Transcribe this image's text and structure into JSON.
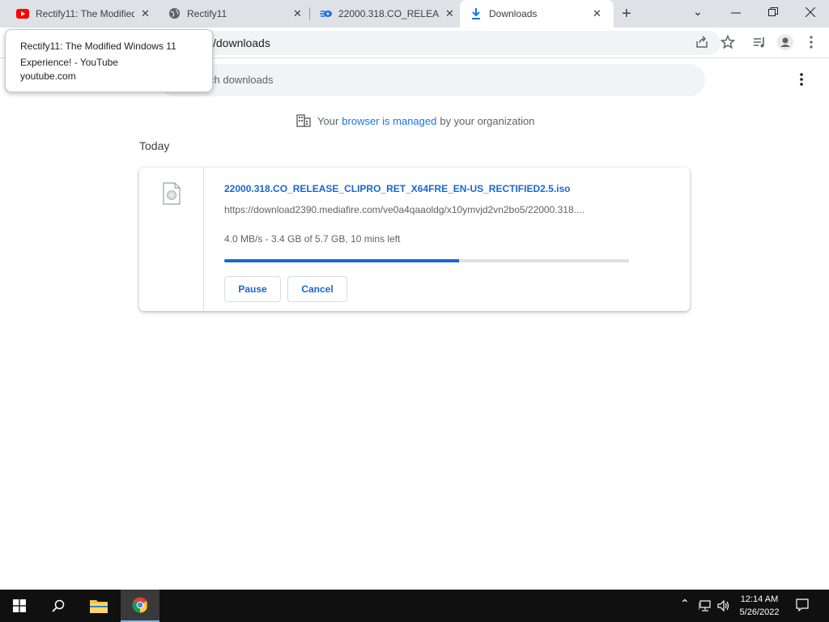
{
  "tabs": [
    {
      "title": "Rectify11: The Modified Windows 11 Experience! - YouTube",
      "icon": "youtube-icon",
      "active": false
    },
    {
      "title": "Rectify11",
      "icon": "globe-icon",
      "active": false
    },
    {
      "title": "22000.318.CO_RELEASE_CLIPRO_RET_X64FRE_EN-US_RECTIFIED2.5.iso",
      "icon": "mediafire-icon",
      "active": false
    },
    {
      "title": "Downloads",
      "icon": "download-icon",
      "active": true
    }
  ],
  "address_bar": {
    "url_visible": "/downloads"
  },
  "search": {
    "placeholder_visible": "ch downloads"
  },
  "managed_notice": {
    "prefix": "Your",
    "link": "browser is managed",
    "suffix": "by your organization"
  },
  "section_date": "Today",
  "download": {
    "file_name": "22000.318.CO_RELEASE_CLIPRO_RET_X64FRE_EN-US_RECTIFIED2.5.iso",
    "url": "https://download2390.mediafire.com/ve0a4qaaoldg/x10ymvjd2vn2bo5/22000.318....",
    "status": "4.0 MB/s - 3.4 GB of 5.7 GB, 10 mins left",
    "progress_fraction": 0.58,
    "pause_label": "Pause",
    "cancel_label": "Cancel"
  },
  "tooltip": {
    "title": "Rectify11: The Modified Windows 11 Experience! - YouTube",
    "domain": "youtube.com"
  },
  "taskbar": {
    "time": "12:14 AM",
    "date": "5/26/2022"
  },
  "colors": {
    "accent": "#1967d2",
    "link": "#1a73e8",
    "tabstrip": "#dee1e6",
    "taskbar": "#101010"
  }
}
